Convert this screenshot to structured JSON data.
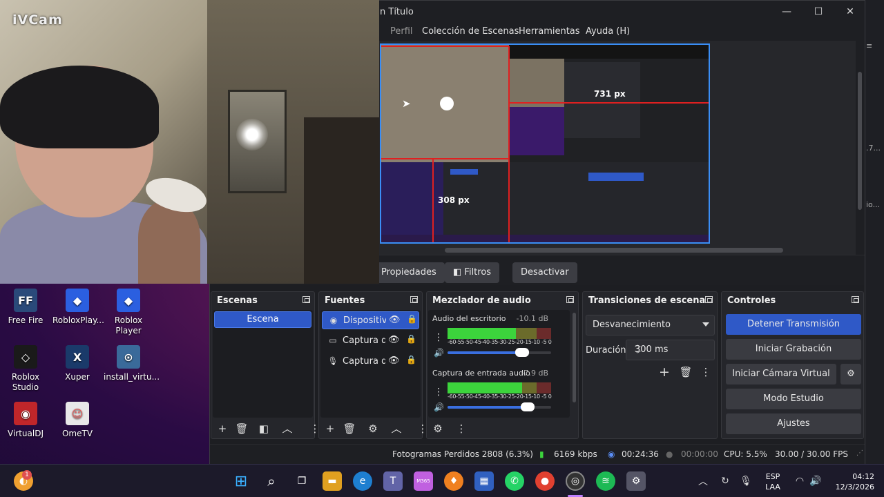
{
  "cam": {
    "logo": "iVCam"
  },
  "desktop_icons": [
    {
      "label": "Free Fire",
      "color": "#2a4a7a"
    },
    {
      "label": "RobloxPlay...",
      "color": "#2b5fe0"
    },
    {
      "label": "Roblox Player",
      "color": "#2b5fe0"
    },
    {
      "label": "Roblox Studio",
      "color": "#1a1a1a"
    },
    {
      "label": "Xuper",
      "color": "#1a3a6a"
    },
    {
      "label": "install_virtu...",
      "color": "#3a6a9a"
    },
    {
      "label": "VirtualDJ",
      "color": "#c0262a"
    },
    {
      "label": "OmeTV",
      "color": "#e8e8e8"
    }
  ],
  "obs": {
    "title": "n Título",
    "menu": [
      "Perfil",
      "Colección de Escenas",
      "Herramientas",
      "Ayuda (H)"
    ],
    "preview": {
      "label_h": "731 px",
      "label_v": "308 px"
    },
    "context": {
      "properties": "Propiedades",
      "filters": "Filtros",
      "deactivate": "Desactivar"
    },
    "scenes": {
      "title": "Escenas",
      "items": [
        "Escena"
      ]
    },
    "sources": {
      "title": "Fuentes",
      "items": [
        {
          "name": "Dispositiv",
          "icon": "camera-icon"
        },
        {
          "name": "Captura d",
          "icon": "monitor-icon"
        },
        {
          "name": "Captura d",
          "icon": "microphone-icon"
        }
      ]
    },
    "mixer": {
      "title": "Mezclador de audio",
      "scale": "-60-55-50-45-40-35-30-25-20-15-10 -5  0",
      "channels": [
        {
          "name": "Audio del escritorio",
          "db": "-10.1 dB",
          "level": 0.66,
          "volume": 0.72
        },
        {
          "name": "Captura de entrada audio",
          "db": "-7.9 dB",
          "level": 0.72,
          "volume": 0.77
        }
      ]
    },
    "transitions": {
      "title": "Transiciones de escena",
      "selected": "Desvanecimiento",
      "duration_label": "Duración",
      "duration": "300 ms"
    },
    "controls": {
      "title": "Controles",
      "stop_stream": "Detener Transmisión",
      "start_rec": "Iniciar Grabación",
      "virtual_cam": "Iniciar Cámara Virtual",
      "studio": "Modo Estudio",
      "settings": "Ajustes"
    },
    "status": {
      "dropped": "Fotogramas Perdidos 2808 (6.3%)",
      "bitrate": "6169 kbps",
      "live_time": "00:24:36",
      "rec_time": "00:00:00",
      "cpu": "CPU: 5.5%",
      "fps": "30.00 / 30.00 FPS"
    }
  },
  "bg_window": {
    "text1": ".7...",
    "text2": "io..."
  },
  "taskbar": {
    "lang1": "ESP",
    "lang2": "LAA",
    "time": "04:12",
    "date": "12/3/2026",
    "badge": "1",
    "m365": "M365"
  }
}
